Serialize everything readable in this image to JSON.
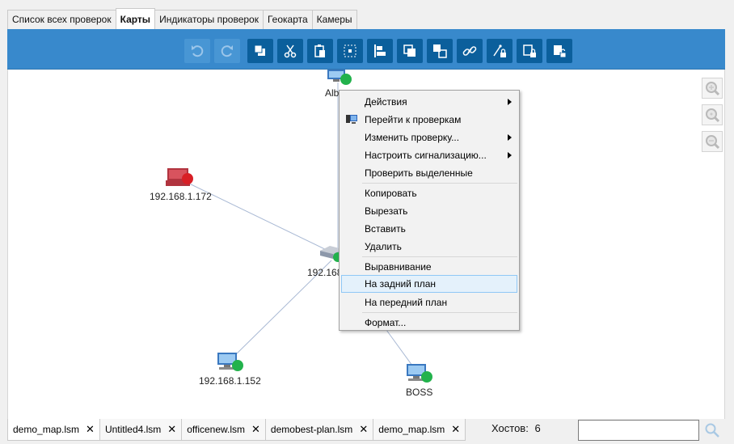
{
  "tabs": [
    "Список всех проверок",
    "Карты",
    "Индикаторы проверок",
    "Геокарта",
    "Камеры"
  ],
  "toolbar": {
    "buttons": [
      "undo",
      "redo",
      "bring-to-front",
      "cut",
      "paste",
      "select-all",
      "align-left",
      "group",
      "ungroup",
      "link",
      "link-lock",
      "lock",
      "unlock"
    ]
  },
  "map": {
    "nodes": [
      {
        "label": "Alb",
        "status": "ok"
      },
      {
        "label": "192.168.1.172",
        "status": "error"
      },
      {
        "label": "192.168",
        "status": "ok"
      },
      {
        "label": "192.168.1.152",
        "status": "ok"
      },
      {
        "label": "BOSS",
        "status": "ok"
      }
    ]
  },
  "context_menu": {
    "items": [
      {
        "label": "Действия",
        "submenu": true
      },
      {
        "label": "Перейти к проверкам",
        "icon": "monitor-icon"
      },
      {
        "label": "Изменить проверку...",
        "submenu": true
      },
      {
        "label": "Настроить сигнализацию...",
        "submenu": true
      },
      {
        "label": "Проверить выделенные"
      },
      {
        "label": "Копировать"
      },
      {
        "label": "Вырезать"
      },
      {
        "label": "Вставить"
      },
      {
        "label": "Удалить"
      },
      {
        "label": "Выравнивание"
      },
      {
        "label": "На задний план",
        "highlighted": true
      },
      {
        "label": "На передний план"
      },
      {
        "label": "Формат..."
      }
    ]
  },
  "file_tabs": [
    "demo_map.lsm",
    "Untitled4.lsm",
    "officenew.lsm",
    "demobest-plan.lsm",
    "demo_map.lsm"
  ],
  "close_glyph": "✕",
  "status": {
    "hosts_label": "Хостов:",
    "hosts_count": "6"
  },
  "search": {
    "value": "",
    "placeholder": ""
  },
  "colors": {
    "toolbar": "#3889cc",
    "button": "#0b5f9c",
    "ok": "#22b24c",
    "error": "#d81f26",
    "highlight": "#e4f1fb"
  }
}
